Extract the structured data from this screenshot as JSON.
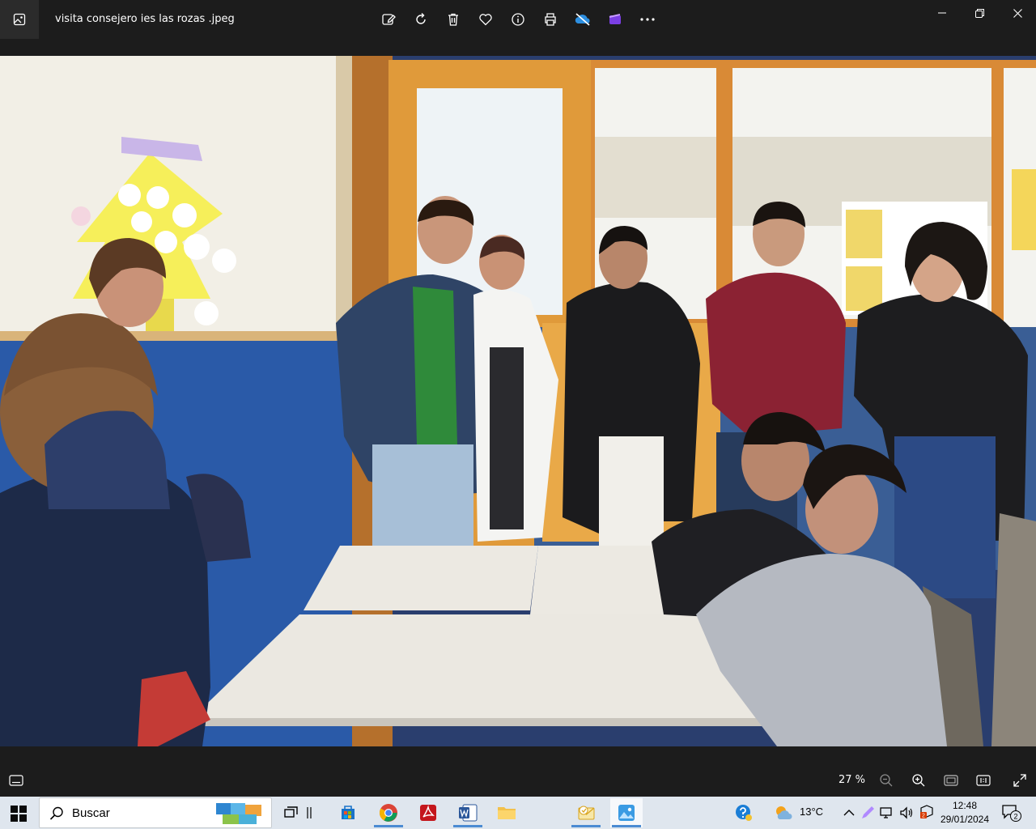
{
  "window": {
    "file_name": "visita consejero ies las rozas .jpeg",
    "toolbar_icons": [
      "edit-image-icon",
      "rotate-icon",
      "delete-icon",
      "favorite-icon",
      "info-icon",
      "print-icon",
      "onedrive-icon",
      "clipchamp-icon",
      "more-icon"
    ],
    "controls": [
      "minimize-icon",
      "restore-icon",
      "close-icon"
    ]
  },
  "bottom_bar": {
    "zoom_level": "27 %",
    "icons": [
      "filmstrip-icon",
      "zoom-out-icon",
      "zoom-in-icon",
      "fit-to-window-icon",
      "actual-size-icon",
      "fullscreen-icon"
    ]
  },
  "taskbar": {
    "search_placeholder": "Buscar",
    "apps": [
      "task-view",
      "widgets-divider",
      "microsoft-store",
      "google-chrome",
      "adobe-acrobat",
      "microsoft-word",
      "file-explorer",
      "outlook",
      "photos"
    ],
    "weather_temp": "13°C",
    "time": "12:48",
    "date": "29/01/2024",
    "notification_count": "2",
    "teams_badge": "2"
  },
  "colors": {
    "titlebar_bg": "#1c1c1c",
    "taskbar_bg": "#dfe6ee",
    "accent": "#4b8bd3"
  }
}
